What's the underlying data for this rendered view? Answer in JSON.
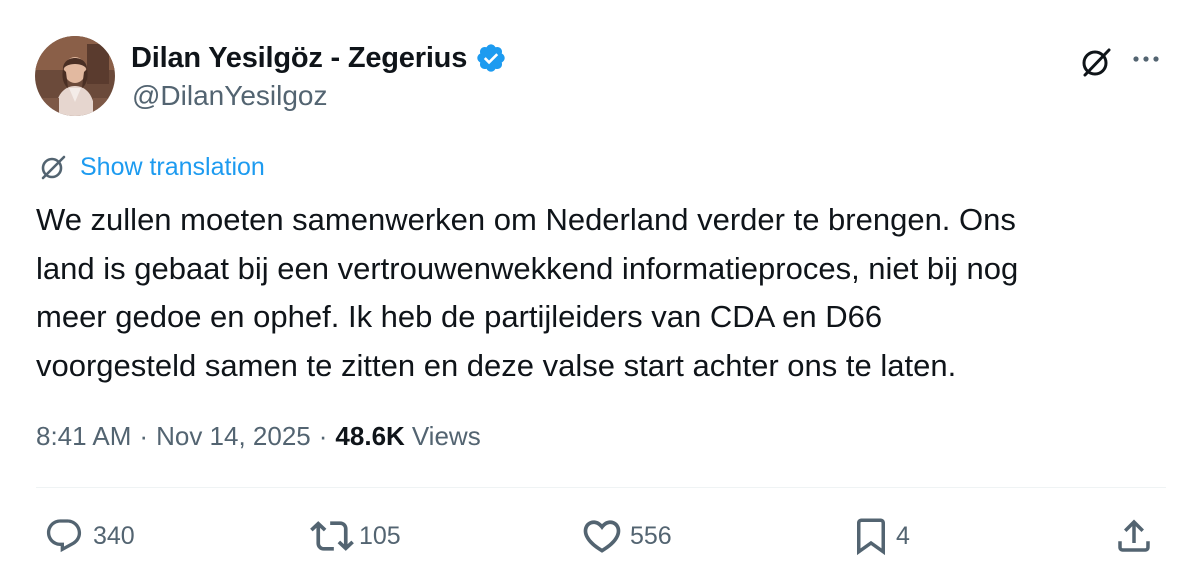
{
  "author": {
    "display_name": "Dilan Yesilgöz - Zegerius",
    "handle": "@DilanYesilgoz",
    "verified": true,
    "avatar": "profile-photo"
  },
  "header_icons": {
    "grok": "grok-icon",
    "more": "more-horizontal-icon"
  },
  "translation": {
    "icon": "grok-icon",
    "label": "Show translation"
  },
  "tweet": {
    "lines": [
      "We zullen moeten samenwerken om Nederland verder te brengen. Ons",
      "land is gebaat bij een vertrouwenwekkend informatieproces, niet bij nog",
      "meer gedoe en ophef. Ik heb de partijleiders van CDA en D66",
      "voorgesteld samen te zitten en deze valse start achter ons te laten."
    ]
  },
  "meta": {
    "time": "8:41 AM",
    "separator": "·",
    "date": "Nov 14, 2025",
    "views_count": "48.6K",
    "views_label": "Views"
  },
  "actions": {
    "replies": "340",
    "reposts": "105",
    "likes": "556",
    "bookmarks": "4"
  },
  "colors": {
    "text_primary": "#0f1419",
    "text_secondary": "#536471",
    "link_blue": "#1d9bf0",
    "verified_blue": "#1d9bf0",
    "divider": "#eff3f4"
  }
}
